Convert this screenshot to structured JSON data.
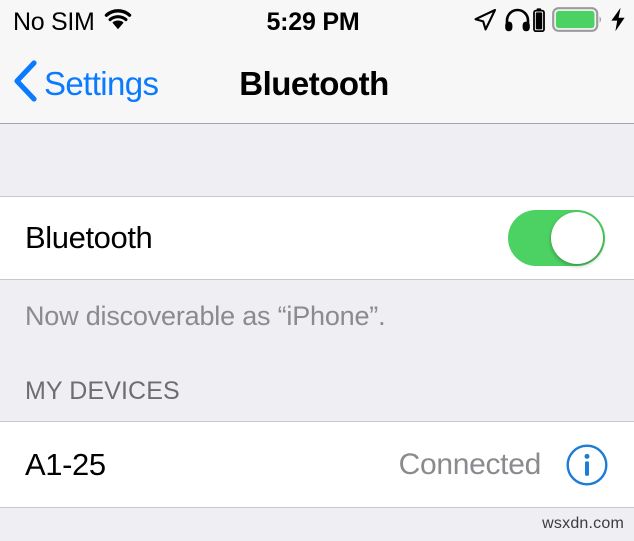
{
  "status_bar": {
    "carrier": "No SIM",
    "wifi_icon": "wifi-icon",
    "time": "5:29 PM",
    "location_icon": "location-arrow-icon",
    "headphones_icon": "headphones-icon",
    "headphone_battery_icon": "headphone-battery-icon",
    "battery_icon": "battery-icon",
    "charging_icon": "lightning-bolt-icon",
    "battery_color": "#4CD263"
  },
  "nav_bar": {
    "back_icon": "chevron-left-icon",
    "back_label": "Settings",
    "title": "Bluetooth",
    "tint_color": "#0A7AFF"
  },
  "bluetooth_row": {
    "label": "Bluetooth",
    "toggle_state": "on",
    "toggle_on_color": "#4CD263"
  },
  "footnote": {
    "text": "Now discoverable as “iPhone”."
  },
  "devices_section": {
    "header": "MY DEVICES",
    "devices": [
      {
        "name": "A1-25",
        "status": "Connected",
        "info_icon": "info-circle-icon"
      }
    ]
  },
  "footer": {
    "watermark": "wsxdn.com"
  }
}
